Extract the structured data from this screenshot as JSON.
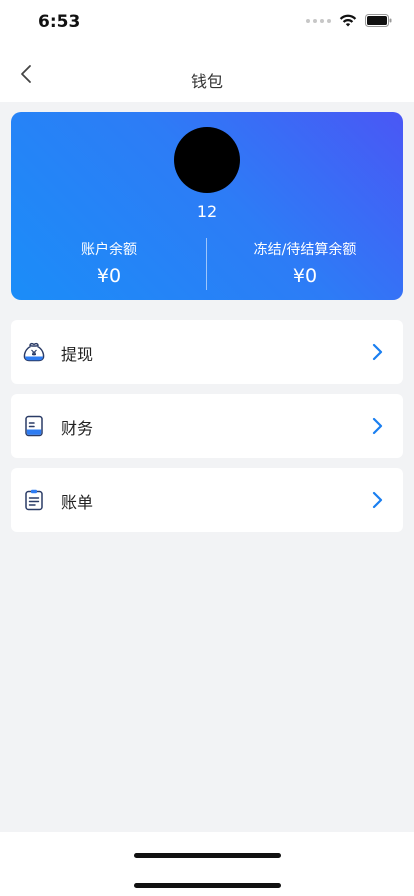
{
  "status_bar": {
    "time": "6:53",
    "icons": [
      "signal-dots-icon",
      "wifi-icon",
      "battery-icon"
    ]
  },
  "navbar": {
    "title": "钱包",
    "back_icon": "chevron-left-icon"
  },
  "wallet": {
    "user_id": "12",
    "account_balance_label": "账户余额",
    "account_balance_value": "¥0",
    "frozen_balance_label": "冻结/待结算余额",
    "frozen_balance_value": "¥0",
    "gradient_colors": [
      "#4a57f5",
      "#1b8df8"
    ]
  },
  "menu": {
    "items": [
      {
        "label": "提现",
        "icon": "money-bag-icon"
      },
      {
        "label": "财务",
        "icon": "finance-document-icon"
      },
      {
        "label": "账单",
        "icon": "clipboard-bill-icon"
      }
    ]
  },
  "colors": {
    "accent": "#1a7ff0",
    "background": "#f2f3f5"
  }
}
